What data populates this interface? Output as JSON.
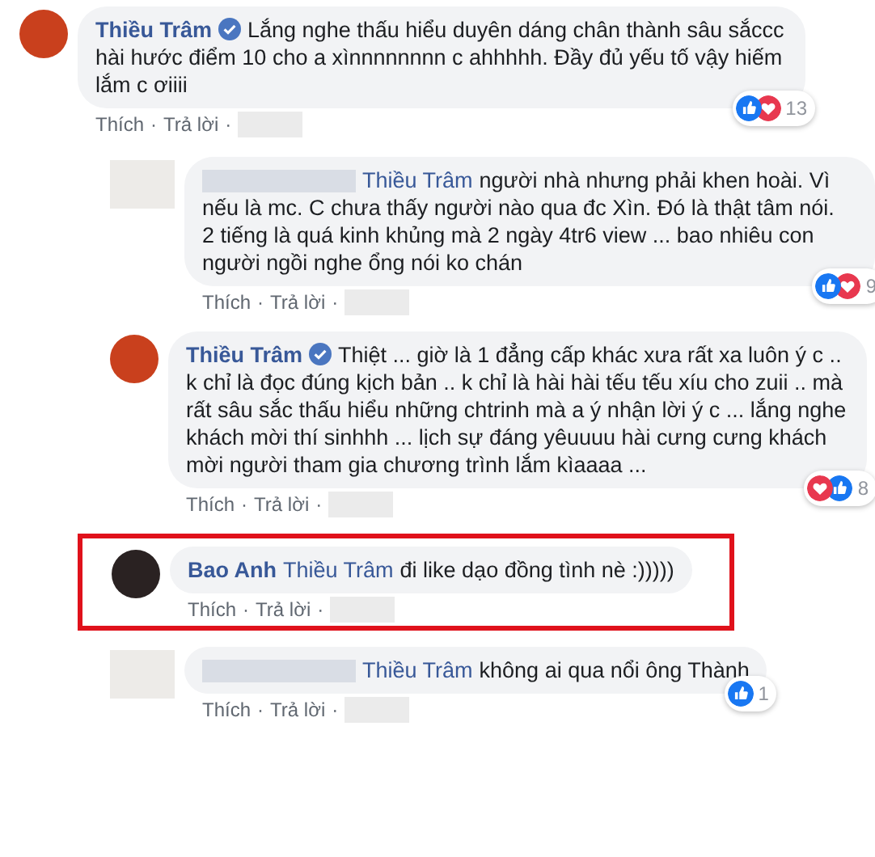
{
  "separator": "·",
  "comments": [
    {
      "author": "Thiều Trâm",
      "author_blurred": false,
      "verified": true,
      "text": "Lắng nghe thấu hiểu duyên dáng chân thành sâu sắccc hài hước điểm 10 cho a xìnnnnnnnn c ahhhhh. Đầy đủ yếu tố vậy hiếm lắm c ơiiii",
      "reactions": [
        {
          "kind": "like"
        },
        {
          "kind": "love"
        }
      ],
      "count": "13",
      "highlighted": false,
      "actions": [
        "Thích",
        "Trả lời"
      ],
      "children": [
        {
          "author_blurred": true,
          "verified": false,
          "mention": "Thiều Trâm",
          "text": "người nhà nhưng phải khen hoài. Vì nếu là mc. C chưa thấy người nào qua đc Xìn. Đó là thật tâm nói.\n2 tiếng là quá kinh khủng mà 2 ngày 4tr6 view ... bao nhiêu con người ngồi nghe ổng nói ko chán",
          "reactions": [
            {
              "kind": "like"
            },
            {
              "kind": "love"
            }
          ],
          "count": "9",
          "highlighted": false,
          "actions": [
            "Thích",
            "Trả lời"
          ]
        },
        {
          "author": "Thiều Trâm",
          "author_blurred": false,
          "verified": true,
          "text": "Thiệt ... giờ là 1 đẳng cấp khác xưa rất xa luôn ý c .. k chỉ là đọc đúng kịch bản .. k chỉ là hài hài tếu tếu xíu cho zuii .. mà rất sâu sắc thấu hiểu những chtrinh mà a ý nhận lời ý c ... lắng nghe khách mời thí sinhhh ... lịch sự đáng yêuuuu hài cưng cưng khách mời người tham gia chương trình lắm kìaaaa ...",
          "reactions": [
            {
              "kind": "love"
            },
            {
              "kind": "like"
            }
          ],
          "count": "8",
          "highlighted": false,
          "actions": [
            "Thích",
            "Trả lời"
          ]
        },
        {
          "author": "Bao Anh",
          "author_blurred": false,
          "verified": false,
          "mention": "Thiều Trâm",
          "text": "đi like dạo đồng tình nè :)))))",
          "highlighted": true,
          "actions": [
            "Thích",
            "Trả lời"
          ]
        },
        {
          "author_blurred": true,
          "verified": false,
          "mention": "Thiều Trâm",
          "text": "không ai qua nổi ông Thành",
          "reactions": [
            {
              "kind": "like"
            }
          ],
          "count": "1",
          "highlighted": false,
          "actions": [
            "Thích",
            "Trả lời"
          ]
        }
      ]
    }
  ]
}
